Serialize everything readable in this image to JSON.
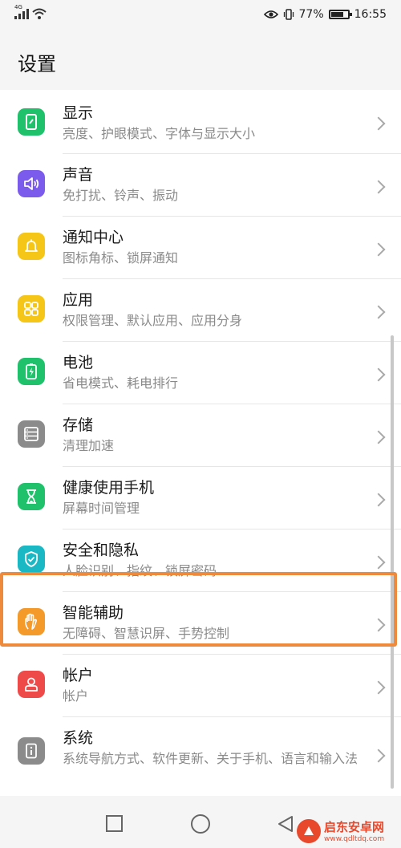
{
  "status_bar": {
    "network_type": "4G",
    "battery_percent": "77%",
    "battery_level": 0.77,
    "time": "16:55"
  },
  "header": {
    "title": "设置"
  },
  "settings": [
    {
      "id": "display",
      "icon": "display-icon",
      "color": "#1fc26b",
      "title": "显示",
      "subtitle": "亮度、护眼模式、字体与显示大小"
    },
    {
      "id": "sound",
      "icon": "speaker-icon",
      "color": "#7b5bec",
      "title": "声音",
      "subtitle": "免打扰、铃声、振动"
    },
    {
      "id": "notifications",
      "icon": "bell-icon",
      "color": "#f5c518",
      "title": "通知中心",
      "subtitle": "图标角标、锁屏通知"
    },
    {
      "id": "apps",
      "icon": "apps-grid-icon",
      "color": "#f5c518",
      "title": "应用",
      "subtitle": "权限管理、默认应用、应用分身"
    },
    {
      "id": "battery",
      "icon": "battery-icon",
      "color": "#1fc26b",
      "title": "电池",
      "subtitle": "省电模式、耗电排行"
    },
    {
      "id": "storage",
      "icon": "storage-icon",
      "color": "#8b8b8b",
      "title": "存储",
      "subtitle": "清理加速"
    },
    {
      "id": "digital_balance",
      "icon": "hourglass-icon",
      "color": "#1fc26b",
      "title": "健康使用手机",
      "subtitle": "屏幕时间管理"
    },
    {
      "id": "security",
      "icon": "shield-check-icon",
      "color": "#19b8c4",
      "title": "安全和隐私",
      "subtitle": "人脸识别、指纹、锁屏密码"
    },
    {
      "id": "smart_assistance",
      "icon": "hand-icon",
      "color": "#f39a2b",
      "title": "智能辅助",
      "subtitle": "无障碍、智慧识屏、手势控制"
    },
    {
      "id": "accounts",
      "icon": "user-icon",
      "color": "#ef4a4a",
      "title": "帐户",
      "subtitle": "帐户"
    },
    {
      "id": "system",
      "icon": "info-icon",
      "color": "#8b8b8b",
      "title": "系统",
      "subtitle": "系统导航方式、软件更新、关于手机、语言和输入法"
    }
  ],
  "nav_bar": {
    "recent": "square-icon",
    "home": "circle-icon",
    "back": "triangle-back-icon"
  },
  "watermark": {
    "line1": "启东安卓网",
    "line2": "www.qdltdq.com"
  }
}
